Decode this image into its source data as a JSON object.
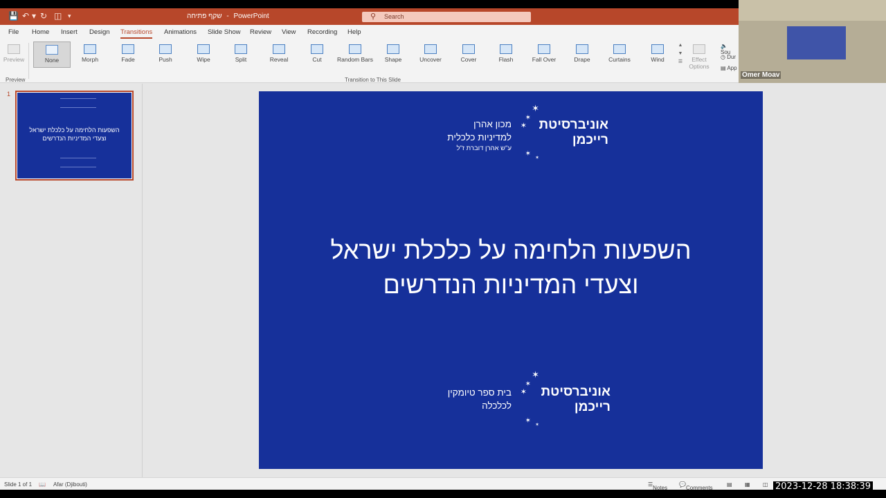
{
  "window": {
    "file_name": "שקף פתיחה",
    "separator": "-",
    "app_name": "PowerPoint",
    "search_placeholder": "Search"
  },
  "menu": [
    "File",
    "Home",
    "Insert",
    "Design",
    "Transitions",
    "Animations",
    "Slide Show",
    "Review",
    "View",
    "Recording",
    "Help"
  ],
  "menu_active": "Transitions",
  "ribbon": {
    "preview_label": "Preview",
    "preview_group": "Preview",
    "transitions_group": "Transition to This Slide",
    "transitions": [
      "None",
      "Morph",
      "Fade",
      "Push",
      "Wipe",
      "Split",
      "Reveal",
      "Cut",
      "Random Bars",
      "Shape",
      "Uncover",
      "Cover",
      "Flash",
      "Fall Over",
      "Drape",
      "Curtains",
      "Wind"
    ],
    "selected_transition": "None",
    "effect_options_1": "Effect",
    "effect_options_2": "Options",
    "side_items": [
      "Sou",
      "Dur",
      "App"
    ]
  },
  "thumbnail": {
    "number": "1",
    "title_line1": "השפעות הלחימה על כלכלת ישראל",
    "title_line2": "וצעדי המדיניות הנדרשים"
  },
  "slide": {
    "top_logo": {
      "uni_line1": "אוניברסיטת",
      "uni_line2": "רייכמן",
      "sub_line1": "מכון אהרן",
      "sub_line2": "למדיניות כלכלית",
      "sub_line3": "ע\"ש אהרן דוברת ז\"ל"
    },
    "title_line1": "השפעות הלחימה על כלכלת ישראל",
    "title_line2": "וצעדי המדיניות הנדרשים",
    "bottom_logo": {
      "uni_line1": "אוניברסיטת",
      "uni_line2": "רייכמן",
      "sub_line1": "בית ספר טיומקין",
      "sub_line2": "לכלכלה"
    },
    "background_color": "#16309a"
  },
  "status": {
    "slide_count": "Slide 1 of 1",
    "language": "Afar (Djibouti)",
    "notes": "Notes",
    "comments": "Comments"
  },
  "video": {
    "participant_name": "Omer Moav"
  },
  "timestamp": "2023-12-28  18:38:39",
  "colors": {
    "accent": "#b7472a",
    "slide_bg": "#16309a"
  }
}
